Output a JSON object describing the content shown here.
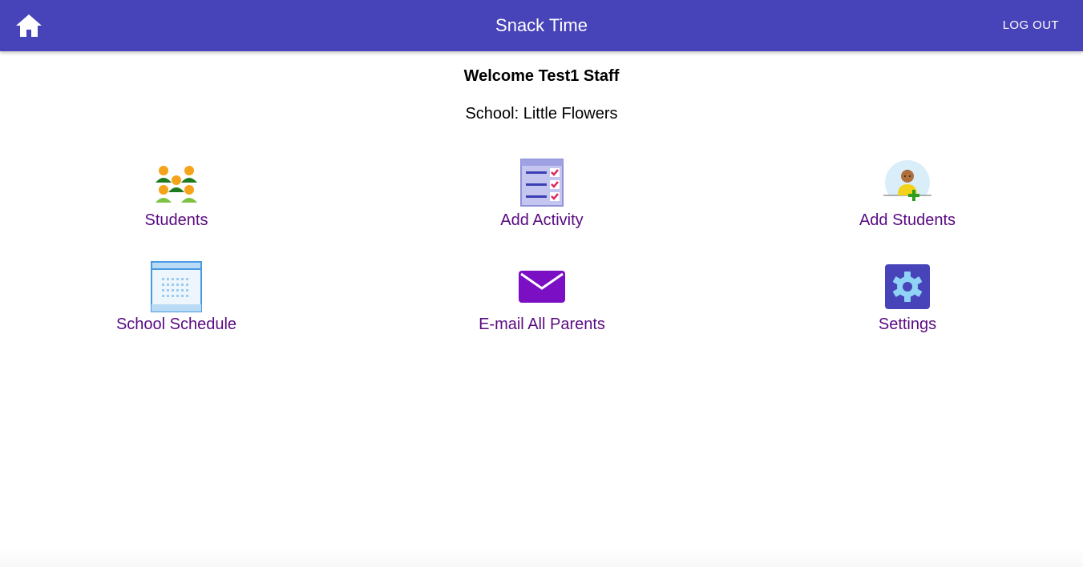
{
  "appbar": {
    "title": "Snack Time",
    "logout_label": "LOG OUT",
    "home_icon": "home-icon",
    "color": "#4743b9"
  },
  "welcome": "Welcome Test1 Staff",
  "school": "School: Little Flowers",
  "tiles": [
    {
      "label": "Students",
      "icon": "students-group-icon"
    },
    {
      "label": "Add Activity",
      "icon": "checklist-icon"
    },
    {
      "label": "Add Students",
      "icon": "add-student-icon"
    },
    {
      "label": "School Schedule",
      "icon": "calendar-icon"
    },
    {
      "label": "E-mail All Parents",
      "icon": "envelope-icon"
    },
    {
      "label": "Settings",
      "icon": "gear-icon"
    }
  ],
  "colors": {
    "tile_label": "#5a0a82",
    "envelope": "#7b0fc3",
    "settings": "#4743b9"
  }
}
